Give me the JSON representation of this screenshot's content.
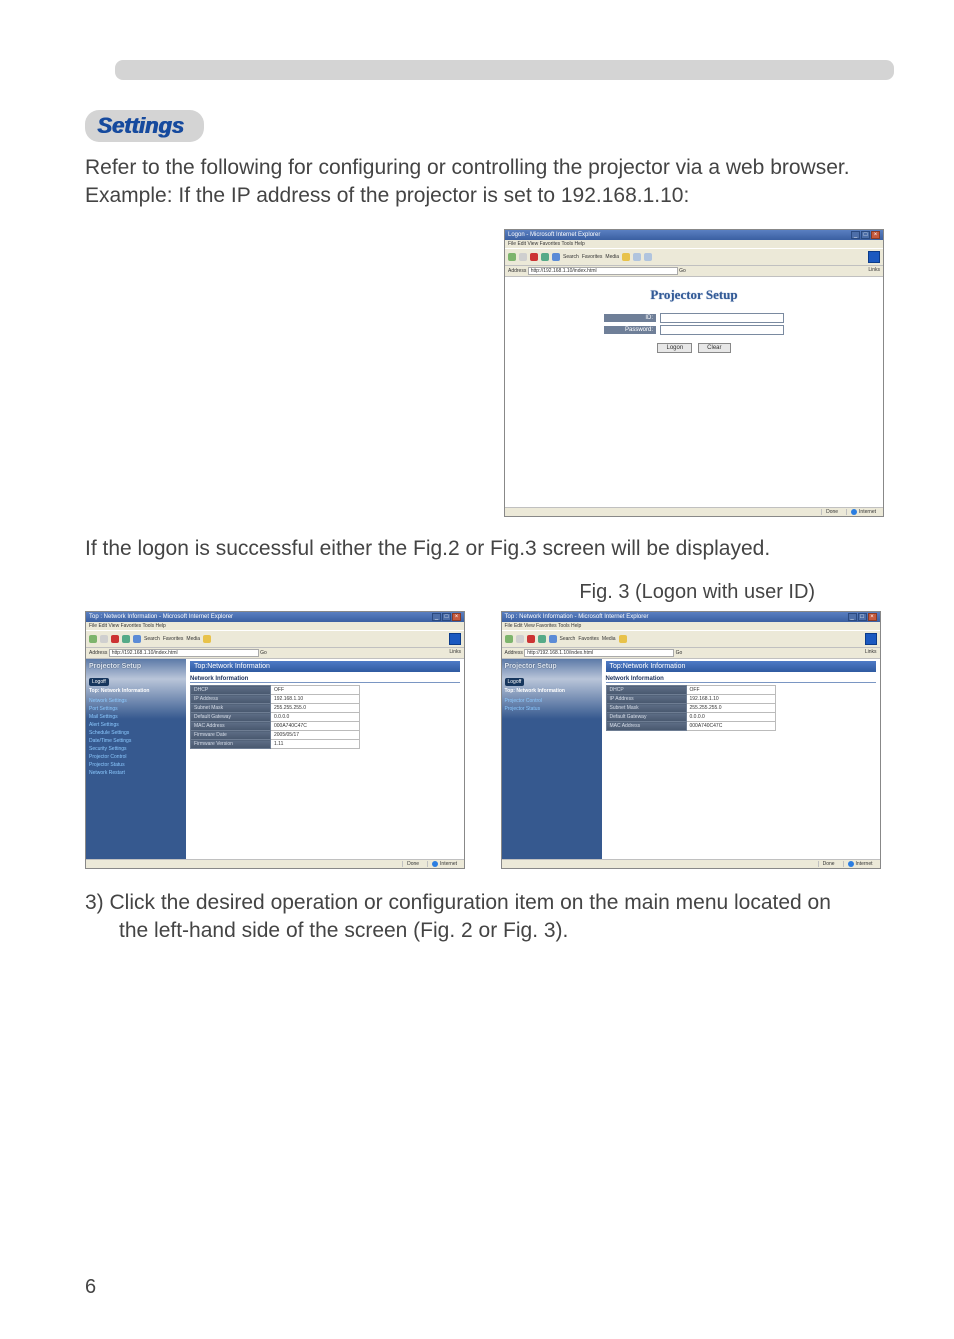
{
  "header_badge": "Settings",
  "intro_p1": "Refer to the following for configuring or controlling the projector via a web browser.",
  "intro_p2": "Example: If the IP address of the projector is set to 192.168.1.10:",
  "after_logon": "If the logon is successful either the Fig.2 or Fig.3 screen will be displayed.",
  "fig3_caption": "Fig. 3 (Logon with user ID)",
  "step3_lead": "3) Click the desired operation or configuration item on the main menu located on",
  "step3_cont": "the left-hand side of the screen (Fig. 2 or Fig. 3).",
  "page_number": "6",
  "ie": {
    "title1": "Logon - Microsoft Internet Explorer",
    "title2": "Top : Network Information - Microsoft Internet Explorer",
    "menu1": "File   Edit   View   Favorites   Tools   Help",
    "addr_label": "Address",
    "addr_val1": "http://192.168.1.10/index.html",
    "go": "Go",
    "links": "Links",
    "zone": "Internet",
    "done": "Done"
  },
  "login": {
    "title": "Projector Setup",
    "id_label": "ID:",
    "pw_label": "Password:",
    "logon_btn": "Logon",
    "clear_btn": "Clear"
  },
  "left": {
    "psetup": "Projector Setup",
    "logoff": "Logoff",
    "top_block": "Top:\nNetwork\nInformation",
    "items_full": [
      "Network Settings",
      "Port Settings",
      "Mail Settings",
      "Alert Settings",
      "Schedule Settings",
      "Date/Time Settings",
      "Security Settings",
      "Projector Control",
      "Projector Status",
      "Network Restart"
    ],
    "items_short": [
      "Projector Control",
      "Projector Status"
    ]
  },
  "crumb": "Top:Network Information",
  "info_section": "Network Information",
  "table_full": [
    {
      "k": "DHCP",
      "v": "OFF"
    },
    {
      "k": "IP Address",
      "v": "192.168.1.10"
    },
    {
      "k": "Subnet Mask",
      "v": "255.255.255.0"
    },
    {
      "k": "Default Gateway",
      "v": "0.0.0.0"
    },
    {
      "k": "MAC Address",
      "v": "000A740C47C"
    },
    {
      "k": "Firmware Date",
      "v": "2005/05/17"
    },
    {
      "k": "Firmware Version",
      "v": "1.11"
    }
  ],
  "table_short": [
    {
      "k": "DHCP",
      "v": "OFF"
    },
    {
      "k": "IP Address",
      "v": "192.168.1.10"
    },
    {
      "k": "Subnet Mask",
      "v": "255.255.255.0"
    },
    {
      "k": "Default Gateway",
      "v": "0.0.0.0"
    },
    {
      "k": "MAC Address",
      "v": "000A740C47C"
    }
  ]
}
